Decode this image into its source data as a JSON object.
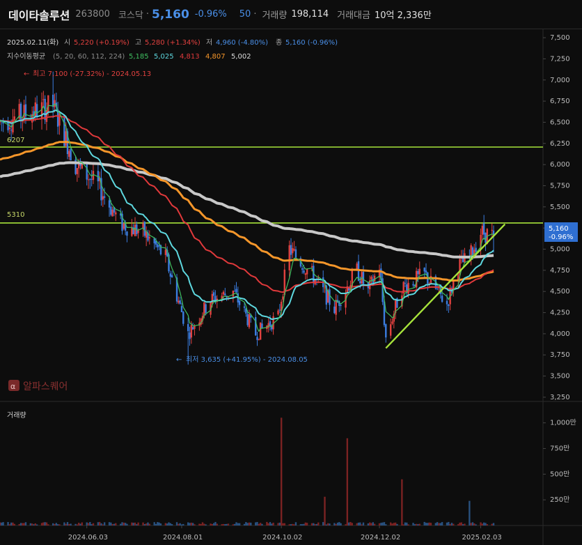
{
  "header": {
    "name": "데이타솔루션",
    "code": "263800",
    "market": "코스닥",
    "price": "5,160",
    "change_pct": "-0.96%",
    "change_abs": "50",
    "volume_label": "거래량",
    "volume": "198,114",
    "amount_label": "거래대금",
    "amount": "10억 2,336만"
  },
  "ohlc": {
    "date": "2025.02.11(화)",
    "open_label": "시",
    "open": "5,220 (+0.19%)",
    "high_label": "고",
    "high": "5,280 (+1.34%)",
    "low_label": "저",
    "low": "4,960 (-4.80%)",
    "close_label": "종",
    "close": "5,160 (-0.96%)"
  },
  "ma_legend": {
    "label": "지수이동평균",
    "params": "(5, 20, 60, 112, 224)",
    "values": [
      "5,185",
      "5,025",
      "4,813",
      "4,807",
      "5,002"
    ]
  },
  "annotations": {
    "high": "최고 7,100 (-27.32%) - 2024.05.13",
    "low": "최저 3,635 (+41.95%) - 2024.08.05",
    "hline_upper": "6207",
    "hline_lower": "5310"
  },
  "current_tag": {
    "price": "5,160",
    "pct": "-0.96%"
  },
  "watermark": "알파스퀘어",
  "volume_panel_title": "거래량",
  "colors": {
    "up": "#e2413f",
    "down": "#3b7de0",
    "hline": "#a7e33b",
    "ma5": "#3fbf60",
    "ma20": "#5ed8df",
    "ma60": "#e0393b",
    "ma112": "#f5962a",
    "ma224": "#c8c8c8"
  },
  "chart_data": {
    "type": "candlestick",
    "y_axis_ticks": [
      "7,500",
      "7,250",
      "7,000",
      "6,750",
      "6,500",
      "6,250",
      "6,000",
      "5,750",
      "5,500",
      "5,250",
      "5,000",
      "4,750",
      "4,500",
      "4,250",
      "4,000",
      "3,750",
      "3,500",
      "3,250"
    ],
    "y_range": [
      3200,
      7550
    ],
    "x_axis_ticks": [
      "2024.06.03",
      "2024.08.01",
      "2024.10.02",
      "2024.12.02",
      "2025.02.03"
    ],
    "volume_axis_ticks": [
      "1,000만",
      "750만",
      "500만",
      "250만"
    ],
    "volume_unit": "만",
    "price_keypoints": [
      [
        "2024.04.10",
        6500
      ],
      [
        "2024.05.13",
        6700
      ],
      [
        "2024.05.27",
        6000
      ],
      [
        "2024.06.10",
        5750
      ],
      [
        "2024.06.24",
        5300
      ],
      [
        "2024.07.08",
        5200
      ],
      [
        "2024.07.22",
        4900
      ],
      [
        "2024.08.05",
        4000
      ],
      [
        "2024.08.19",
        4400
      ],
      [
        "2024.09.02",
        4500
      ],
      [
        "2024.09.16",
        4000
      ],
      [
        "2024.09.30",
        4200
      ],
      [
        "2024.10.07",
        5000
      ],
      [
        "2024.10.21",
        4700
      ],
      [
        "2024.11.04",
        4300
      ],
      [
        "2024.11.18",
        4750
      ],
      [
        "2024.11.25",
        4500
      ],
      [
        "2024.12.02",
        4800
      ],
      [
        "2024.12.06",
        3950
      ],
      [
        "2024.12.16",
        4550
      ],
      [
        "2024.12.30",
        4700
      ],
      [
        "2025.01.13",
        4350
      ],
      [
        "2025.01.20",
        4800
      ],
      [
        "2025.01.27",
        4900
      ],
      [
        "2025.02.03",
        5200
      ],
      [
        "2025.02.11",
        5160
      ]
    ],
    "hlines": [
      6207,
      5310
    ],
    "trendline": [
      [
        "2024.12.06",
        3830
      ],
      [
        "2025.02.12",
        5180
      ]
    ],
    "ma_last": {
      "ma5": 5185,
      "ma20": 5025,
      "ma60": 4813,
      "ma112": 4807,
      "ma224": 5002
    },
    "volume_spikes_man": [
      [
        "2024.10.02",
        1050
      ],
      [
        "2024.11.12",
        850
      ],
      [
        "2024.10.29",
        280
      ],
      [
        "2024.12.16",
        450
      ],
      [
        "2025.01.27",
        240
      ]
    ]
  }
}
